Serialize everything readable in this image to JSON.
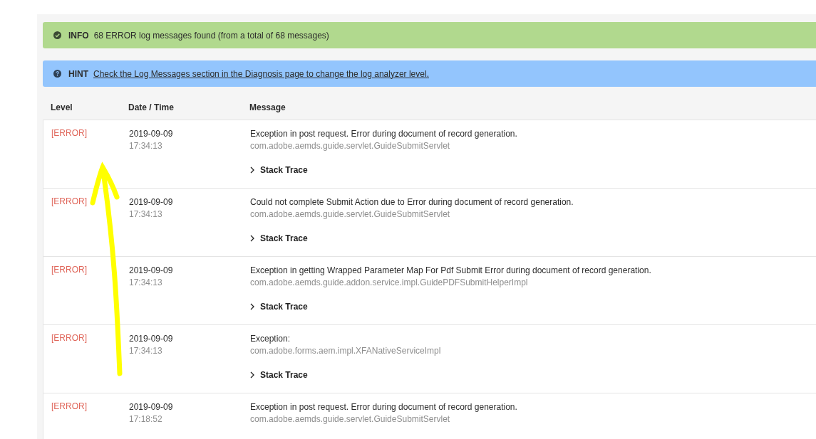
{
  "info_banner": {
    "label": "INFO",
    "text": "68 ERROR log messages found (from a total of 68 messages)"
  },
  "hint_banner": {
    "label": "HINT",
    "link": "Check the Log Messages section in the Diagnosis page to change the log analyzer level."
  },
  "table": {
    "columns": [
      "Level",
      "Date / Time",
      "Message"
    ],
    "rows": [
      {
        "level": "[ERROR]",
        "date": "2019-09-09",
        "time": "17:34:13",
        "message": "Exception in post request. Error during document of record generation.",
        "source": "com.adobe.aemds.guide.servlet.GuideSubmitServlet",
        "stack_trace": {
          "label": "Stack Trace",
          "expanded": false
        }
      },
      {
        "level": "[ERROR]",
        "date": "2019-09-09",
        "time": "17:34:13",
        "message": "Could not complete Submit Action due to Error during document of record generation.",
        "source": "com.adobe.aemds.guide.servlet.GuideSubmitServlet",
        "stack_trace": {
          "label": "Stack Trace",
          "expanded": false
        }
      },
      {
        "level": "[ERROR]",
        "date": "2019-09-09",
        "time": "17:34:13",
        "message": "Exception in getting Wrapped Parameter Map For Pdf Submit Error during document of record generation.",
        "source": "com.adobe.aemds.guide.addon.service.impl.GuidePDFSubmitHelperImpl",
        "stack_trace": {
          "label": "Stack Trace",
          "expanded": false
        }
      },
      {
        "level": "[ERROR]",
        "date": "2019-09-09",
        "time": "17:34:13",
        "message": "Exception:",
        "source": "com.adobe.forms.aem.impl.XFANativeServiceImpl",
        "stack_trace": {
          "label": "Stack Trace",
          "expanded": false
        }
      },
      {
        "level": "[ERROR]",
        "date": "2019-09-09",
        "time": "17:18:52",
        "message": "Exception in post request. Error during document of record generation.",
        "source": "com.adobe.aemds.guide.servlet.GuideSubmitServlet"
      }
    ]
  }
}
